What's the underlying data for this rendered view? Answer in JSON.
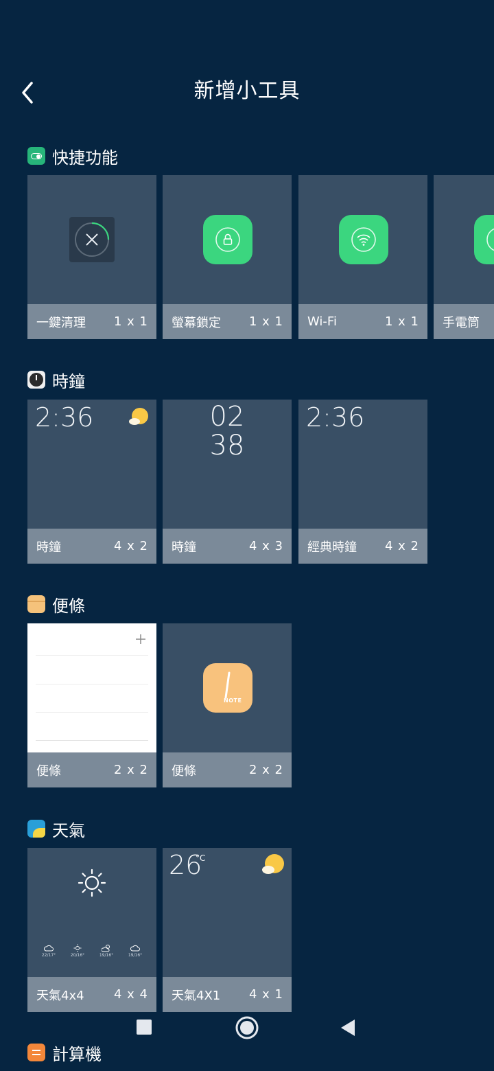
{
  "header": {
    "title": "新增小工具"
  },
  "sections": [
    {
      "title": "快捷功能",
      "cards": [
        {
          "label": "一鍵清理",
          "size": "1 x 1"
        },
        {
          "label": "螢幕鎖定",
          "size": "1 x 1"
        },
        {
          "label": "Wi-Fi",
          "size": "1 x 1"
        },
        {
          "label": "手電筒",
          "size": ""
        }
      ]
    },
    {
      "title": "時鐘",
      "cards": [
        {
          "label": "時鐘",
          "size": "4 x 2",
          "time": "2:36"
        },
        {
          "label": "時鐘",
          "size": "4 x 3",
          "hour": "02",
          "minute": "38"
        },
        {
          "label": "經典時鐘",
          "size": "4 x 2",
          "time": "2:36"
        }
      ]
    },
    {
      "title": "便條",
      "cards": [
        {
          "label": "便條",
          "size": "2 x 2"
        },
        {
          "label": "便條",
          "size": "2 x 2",
          "icon_text": "NOTE"
        }
      ]
    },
    {
      "title": "天氣",
      "cards": [
        {
          "label": "天氣4x4",
          "size": "4 x 4",
          "forecast": [
            {
              "icon": "cloud-icon",
              "temp": "22/17°"
            },
            {
              "icon": "sun-icon",
              "temp": "20/16°"
            },
            {
              "icon": "cloud-sun-icon",
              "temp": "19/16°"
            },
            {
              "icon": "cloud-icon",
              "temp": "19/16°"
            }
          ]
        },
        {
          "label": "天氣4X1",
          "size": "4 x 1",
          "temp": "26",
          "unit": "°C"
        }
      ]
    },
    {
      "title": "計算機"
    }
  ],
  "colors": {
    "background": "#062541",
    "card": "#394f65",
    "card_footer": "#7b8a99",
    "accent_green": "#3bd67f",
    "note_orange": "#f5c27b",
    "sun_yellow": "#f9c846"
  }
}
